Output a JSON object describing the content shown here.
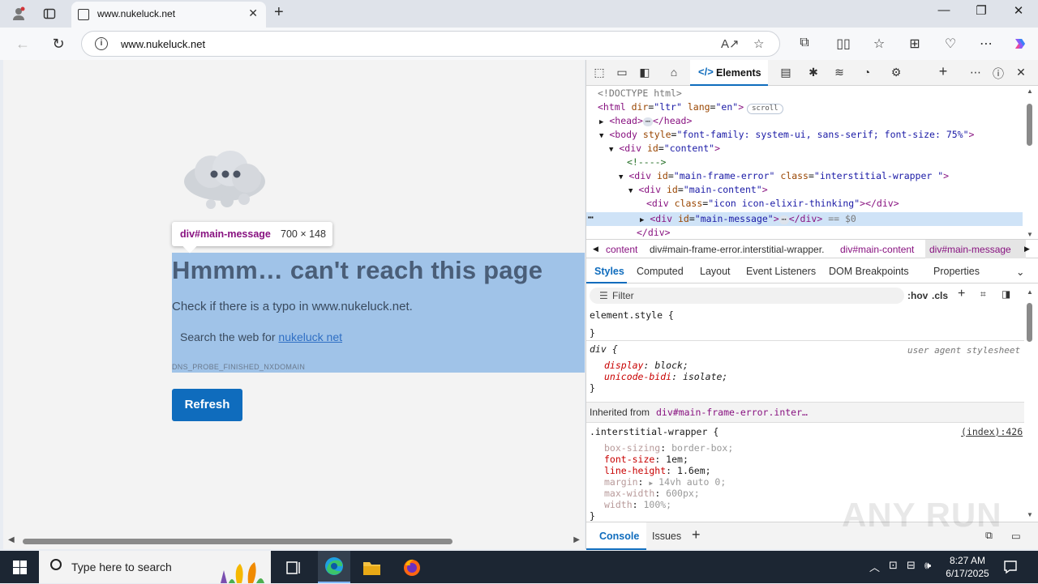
{
  "browser": {
    "tab_title": "www.nukeluck.net",
    "url": "www.nukeluck.net"
  },
  "page": {
    "tooltip_selector": "div#main-message",
    "tooltip_size": "700 × 148",
    "heading": "Hmmm… can't reach this page",
    "typo_text": "Check if there is a typo in www.nukeluck.net.",
    "search_prefix": "Search the web for ",
    "search_link": "nukeluck net",
    "error_code": "DNS_PROBE_FINISHED_NXDOMAIN",
    "refresh_label": "Refresh"
  },
  "devtools": {
    "active_tab": "Elements",
    "dom": {
      "doctype": "<!DOCTYPE html>",
      "html_open": "<html",
      "html_dir_attr": "dir",
      "html_dir_val": "\"ltr\"",
      "html_lang_attr": "lang",
      "html_lang_val": "\"en\"",
      "scroll_badge": "scroll",
      "head": "<head>",
      "head_close": "</head>",
      "body_open": "<body",
      "body_style_attr": "style",
      "body_style_val": "\"font-family: system-ui, sans-serif; font-size: 75%\"",
      "content_div": "<div",
      "content_id_attr": "id",
      "content_id_val": "\"content\"",
      "comment": "<!---->",
      "mfe_id_val": "\"main-frame-error\"",
      "mfe_class_attr": "class",
      "mfe_class_val": "\"interstitial-wrapper \"",
      "mc_id_val": "\"main-content\"",
      "icon_class_val": "\"icon icon-elixir-thinking\"",
      "div_close": "</div>",
      "mm_id_val": "\"main-message\"",
      "eq_sel": "== $0"
    },
    "breadcrumbs": [
      "content",
      "div#main-frame-error.interstitial-wrapper.",
      "div#main-content",
      "div#main-message"
    ],
    "subtabs": [
      "Styles",
      "Computed",
      "Layout",
      "Event Listeners",
      "DOM Breakpoints",
      "Properties"
    ],
    "filter_placeholder": "Filter",
    "hov": ":hov",
    "cls": ".cls",
    "styles": {
      "element_style": "element.style {",
      "close_brace": "}",
      "div_selector": "div {",
      "ua_label": "user agent stylesheet",
      "display_prop": "display",
      "display_val": "block;",
      "unicode_prop": "unicode-bidi",
      "unicode_val": "isolate;",
      "inherited_label": "Inherited from",
      "inherited_from": "div#main-frame-error.inter…",
      "iw_selector": ".interstitial-wrapper {",
      "iw_source": "(index):426",
      "bs_prop": "box-sizing",
      "bs_val": "border-box;",
      "fs_prop": "font-size",
      "fs_val": "1em;",
      "lh_prop": "line-height",
      "lh_val": "1.6em;",
      "mg_prop": "margin",
      "mg_val": "14vh auto 0;",
      "mw_prop": "max-width",
      "mw_val": "600px;",
      "w_prop": "width",
      "w_val": "100%;"
    },
    "drawer_tabs": [
      "Console",
      "Issues"
    ]
  },
  "taskbar": {
    "search_placeholder": "Type here to search",
    "time": "8:27 AM",
    "date": "6/17/2025"
  },
  "watermark": "ANY RUN",
  "colors": {
    "accent": "#0f6cbd",
    "highlight": "#a0c3e8",
    "tag": "#881280"
  }
}
